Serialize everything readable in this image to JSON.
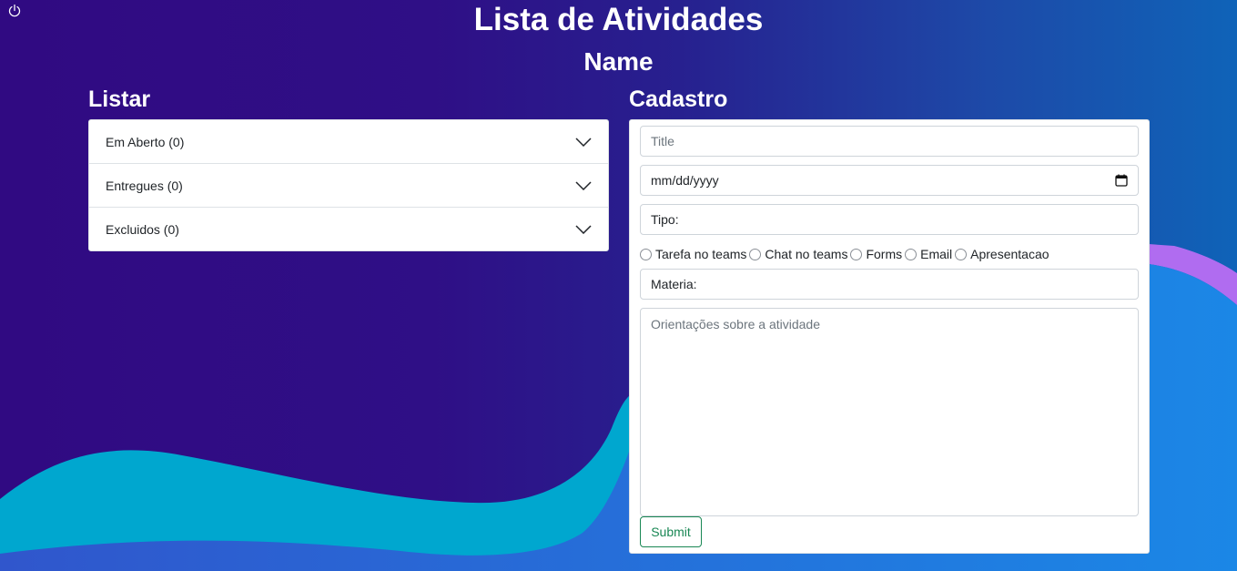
{
  "header": {
    "title": "Lista de Atividades",
    "name": "Name",
    "power_icon": "power-icon"
  },
  "listar": {
    "title": "Listar",
    "items": [
      {
        "label": "Em Aberto (0)",
        "icon": "chevron-down-icon"
      },
      {
        "label": "Entregues (0)",
        "icon": "chevron-down-icon"
      },
      {
        "label": "Excluidos (0)",
        "icon": "chevron-down-icon"
      }
    ]
  },
  "cadastro": {
    "title": "Cadastro",
    "title_placeholder": "Title",
    "date_value": "mm/dd/yyyy",
    "date_icon": "calendar-icon",
    "tipo_value": "Tipo:",
    "radio_options": [
      "Tarefa no teams",
      "Chat no teams",
      "Forms",
      "Email",
      "Apresentacao"
    ],
    "materia_value": "Materia:",
    "orientacoes_placeholder": "Orientações sobre a atividade",
    "submit_label": "Submit"
  },
  "colors": {
    "background_start": "#300a82",
    "background_end": "#0f63b8",
    "wave_cyan": "#00a7cf",
    "wave_blue": "#2f5fcc",
    "wave_violet": "#b06cf0",
    "submit": "#198754"
  }
}
